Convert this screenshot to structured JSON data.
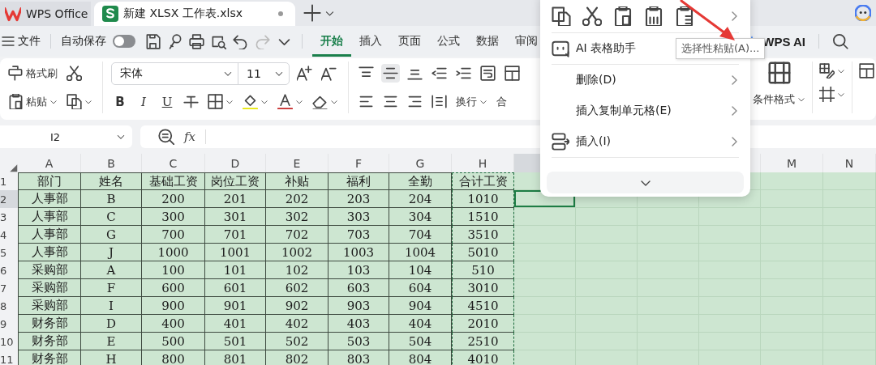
{
  "title_bar": {
    "tabs": [
      {
        "label": "WPS Office",
        "selected": false
      },
      {
        "label": "新建 XLSX 工作表.xlsx",
        "selected": true
      }
    ]
  },
  "menu_bar": {
    "file": "文件",
    "autosave": {
      "label": "自动保存",
      "on": false
    },
    "tabs": [
      {
        "label": "开始",
        "selected": true
      },
      {
        "label": "插入",
        "selected": false
      },
      {
        "label": "页面",
        "selected": false
      },
      {
        "label": "公式",
        "selected": false
      },
      {
        "label": "数据",
        "selected": false
      },
      {
        "label": "审阅",
        "selected": false
      }
    ],
    "ai_button": "WPS AI"
  },
  "ribbon": {
    "format_painter": "格式刷",
    "paste": "粘贴",
    "font_name": "宋体",
    "font_size": "11",
    "style_buttons": [
      "B",
      "I",
      "U"
    ],
    "wrap": "换行",
    "merge": "合",
    "conditional_format": "条件格式"
  },
  "formula_bar": {
    "cell_ref": "I2",
    "fx": "fx"
  },
  "sheet": {
    "columns": [
      {
        "label": "A",
        "selected": false,
        "copied": false
      },
      {
        "label": "B",
        "selected": false,
        "copied": false
      },
      {
        "label": "C",
        "selected": false,
        "copied": false
      },
      {
        "label": "D",
        "selected": false,
        "copied": false
      },
      {
        "label": "E",
        "selected": false,
        "copied": false
      },
      {
        "label": "F",
        "selected": false,
        "copied": false
      },
      {
        "label": "G",
        "selected": false,
        "copied": false
      },
      {
        "label": "H",
        "selected": false,
        "copied": true
      },
      {
        "selected": true,
        "copied": false
      },
      {
        "selected": false,
        "copied": false
      },
      {
        "selected": false,
        "copied": false
      },
      {
        "selected": false,
        "copied": false
      },
      {
        "label": "M",
        "selected": false,
        "copied": false
      },
      {
        "label": "N",
        "selected": false,
        "copied": false
      }
    ],
    "rows": [
      {
        "label": "1",
        "selected": false,
        "cells": [
          "部门",
          "姓名",
          "基础工资",
          "岗位工资",
          "补贴",
          "福利",
          "全勤",
          "合计工资"
        ]
      },
      {
        "label": "2",
        "selected": true,
        "cells": [
          "人事部",
          "B",
          "200",
          "201",
          "202",
          "203",
          "204",
          "1010"
        ]
      },
      {
        "label": "3",
        "selected": false,
        "cells": [
          "人事部",
          "C",
          "300",
          "301",
          "302",
          "303",
          "304",
          "1510"
        ]
      },
      {
        "label": "4",
        "selected": false,
        "cells": [
          "人事部",
          "G",
          "700",
          "701",
          "702",
          "703",
          "704",
          "3510"
        ]
      },
      {
        "label": "5",
        "selected": false,
        "cells": [
          "人事部",
          "J",
          "1000",
          "1001",
          "1002",
          "1003",
          "1004",
          "5010"
        ]
      },
      {
        "label": "6",
        "selected": false,
        "cells": [
          "采购部",
          "A",
          "100",
          "101",
          "102",
          "103",
          "104",
          "510"
        ]
      },
      {
        "label": "7",
        "selected": false,
        "cells": [
          "采购部",
          "F",
          "600",
          "601",
          "602",
          "603",
          "604",
          "3010"
        ]
      },
      {
        "label": "8",
        "selected": false,
        "cells": [
          "采购部",
          "I",
          "900",
          "901",
          "902",
          "903",
          "904",
          "4510"
        ]
      },
      {
        "label": "9",
        "selected": false,
        "cells": [
          "财务部",
          "D",
          "400",
          "401",
          "402",
          "403",
          "404",
          "2010"
        ]
      },
      {
        "label": "10",
        "selected": false,
        "cells": [
          "财务部",
          "E",
          "500",
          "501",
          "502",
          "503",
          "504",
          "2510"
        ]
      },
      {
        "label": "11",
        "selected": false,
        "cells": [
          "财务部",
          "H",
          "800",
          "801",
          "802",
          "803",
          "804",
          "4010"
        ]
      }
    ]
  },
  "context_menu": {
    "items": [
      {
        "kind": "assistant",
        "label": "AI 表格助手"
      },
      {
        "kind": "divider"
      },
      {
        "kind": "submenu",
        "label": "删除(D)"
      },
      {
        "kind": "submenu",
        "label": "插入复制单元格(E)"
      },
      {
        "kind": "insert",
        "label": "插入(I)"
      },
      {
        "kind": "divider"
      }
    ],
    "tooltip": "选择性粘贴(A)..."
  }
}
